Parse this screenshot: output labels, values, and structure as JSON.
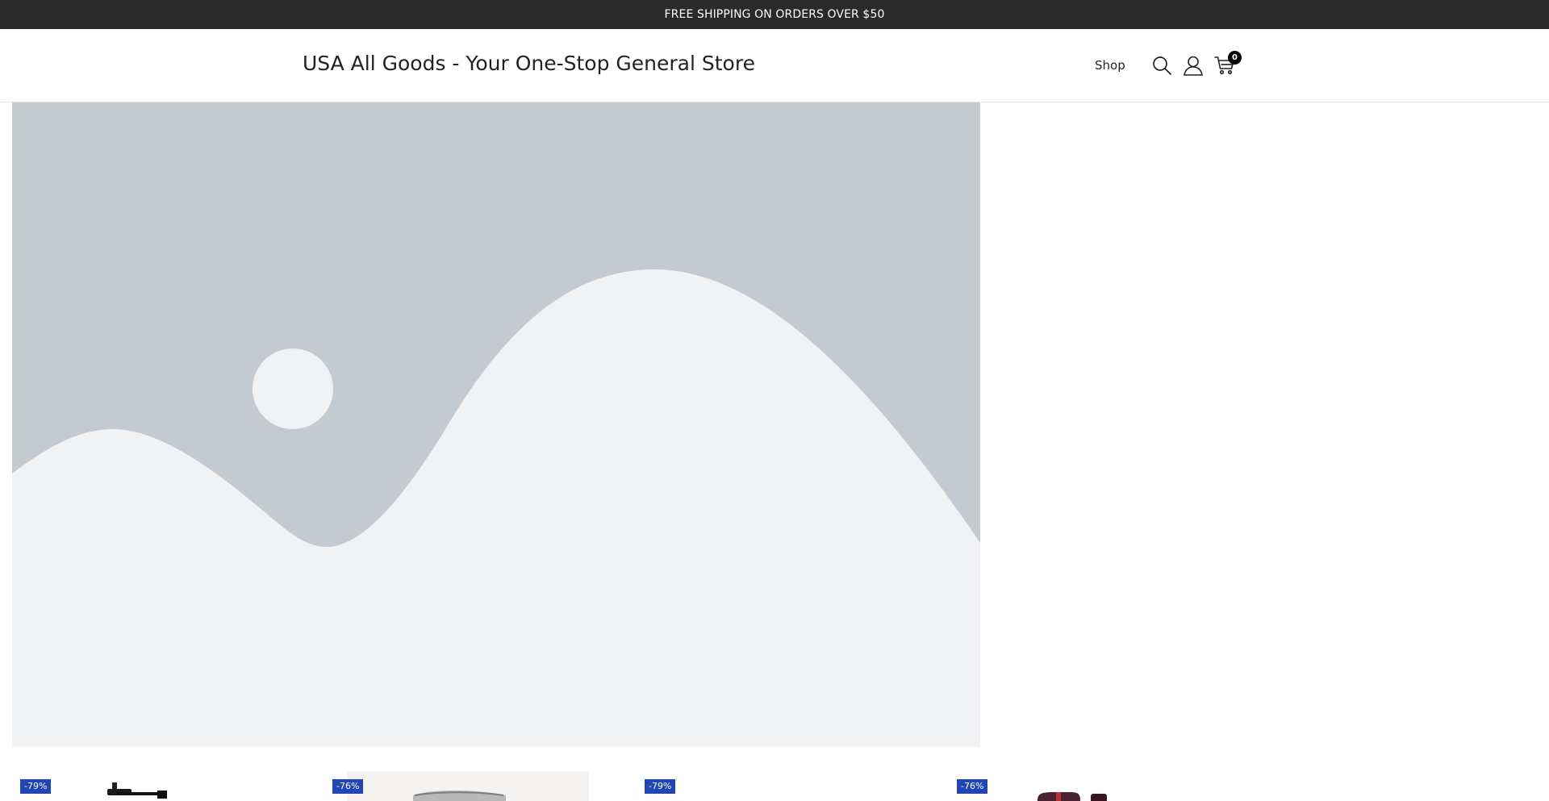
{
  "announcement": {
    "text": "FREE SHIPPING ON ORDERS OVER $50"
  },
  "header": {
    "store_title": "USA All Goods - Your One-Stop General Store",
    "nav": {
      "shop_label": "Shop"
    },
    "icons": {
      "search": "search-icon",
      "account": "user-icon",
      "cart": "cart-icon"
    },
    "cart_count": "0"
  },
  "hero": {
    "image": "image-placeholder-icon"
  },
  "products": [
    {
      "badge": "-79%",
      "image": "coffee-grinder-image"
    },
    {
      "badge": "-76%",
      "image": "steel-container-image"
    },
    {
      "badge": "-79%",
      "image": "product-image"
    },
    {
      "badge": "-76%",
      "image": "red-bottle-image"
    }
  ],
  "colors": {
    "announcement_bg": "#2a2a2a",
    "badge_bg": "#1f46b3",
    "hero_bg": "#c3cad0",
    "hero_fg": "#f0f2f3"
  }
}
